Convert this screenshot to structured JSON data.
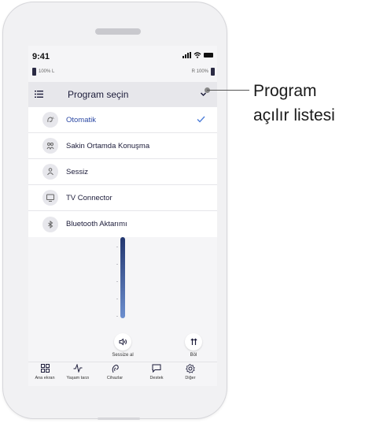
{
  "status": {
    "time": "9:41",
    "left_battery": "100% L",
    "right_battery": "R 100%"
  },
  "dropdown": {
    "title": "Program seçin",
    "items": [
      {
        "label": "Otomatik",
        "icon": "auto-program-icon",
        "selected": true
      },
      {
        "label": "Sakin Ortamda Konuşma",
        "icon": "speech-quiet-icon",
        "selected": false
      },
      {
        "label": "Sessiz",
        "icon": "quiet-icon",
        "selected": false
      },
      {
        "label": "TV Connector",
        "icon": "tv-icon",
        "selected": false
      },
      {
        "label": "Bluetooth Aktarımı",
        "icon": "bluetooth-icon",
        "selected": false
      }
    ]
  },
  "controls": {
    "mute_label": "Sessize al",
    "split_label": "Böl",
    "volume_level": 1.0
  },
  "tabs": [
    {
      "label": "Ana ekran",
      "icon": "home-grid-icon"
    },
    {
      "label": "Yaşam tarzı",
      "icon": "activity-icon"
    },
    {
      "label": "Cihazlar",
      "icon": "hearing-aid-icon"
    },
    {
      "label": "Destek",
      "icon": "chat-icon"
    },
    {
      "label": "Diğer",
      "icon": "gear-icon"
    }
  ],
  "callout": {
    "line1": "Program",
    "line2": "açılır listesi"
  },
  "colors": {
    "accent": "#2d4aa5",
    "check": "#4a7bd8",
    "slider_top": "#22366f",
    "slider_bottom": "#6d8fcf"
  }
}
